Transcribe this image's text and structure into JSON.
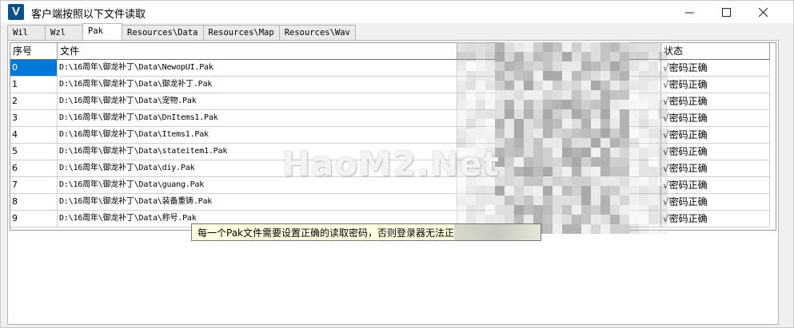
{
  "window": {
    "title": "客户端按照以下文件读取",
    "icon_letter": "V",
    "controls": {
      "minimize": "─",
      "maximize": "☐",
      "close": "✕"
    }
  },
  "tabs": [
    {
      "label": "Wil"
    },
    {
      "label": "Wzl"
    },
    {
      "label": "Pak",
      "active": true
    },
    {
      "label": "Resources\\Data"
    },
    {
      "label": "Resources\\Map"
    },
    {
      "label": "Resources\\Wav"
    }
  ],
  "table": {
    "columns": {
      "index": "序号",
      "file": "文件",
      "status": "状态"
    },
    "rows": [
      {
        "index": "0",
        "file": "D:\\16周年\\御龙补丁\\Data\\NewopUI.Pak",
        "status": "√密码正确"
      },
      {
        "index": "1",
        "file": "D:\\16周年\\御龙补丁\\Data\\御龙补丁.Pak",
        "status": "√密码正确"
      },
      {
        "index": "2",
        "file": "D:\\16周年\\御龙补丁\\Data\\宠物.Pak",
        "status": "√密码正确"
      },
      {
        "index": "3",
        "file": "D:\\16周年\\御龙补丁\\Data\\DnItems1.Pak",
        "status": "√密码正确"
      },
      {
        "index": "4",
        "file": "D:\\16周年\\御龙补丁\\Data\\Items1.Pak",
        "status": "√密码正确"
      },
      {
        "index": "5",
        "file": "D:\\16周年\\御龙补丁\\Data\\stateitem1.Pak",
        "status": "√密码正确"
      },
      {
        "index": "6",
        "file": "D:\\16周年\\御龙补丁\\Data\\diy.Pak",
        "status": "√密码正确"
      },
      {
        "index": "7",
        "file": "D:\\16周年\\御龙补丁\\Data\\guang.Pak",
        "status": "√密码正确"
      },
      {
        "index": "8",
        "file": "D:\\16周年\\御龙补丁\\Data\\装备重铸.Pak",
        "status": "√密码正确"
      },
      {
        "index": "9",
        "file": "D:\\16周年\\御龙补丁\\Data\\称号.Pak",
        "status": "√密码正确"
      }
    ]
  },
  "hint": "每一个Pak文件需要设置正确的读取密码，否则登录器无法正",
  "watermark": "HaoM2.Net",
  "colors": {
    "selection": "#0078d7",
    "tooltip_bg": "#ffffe1"
  }
}
